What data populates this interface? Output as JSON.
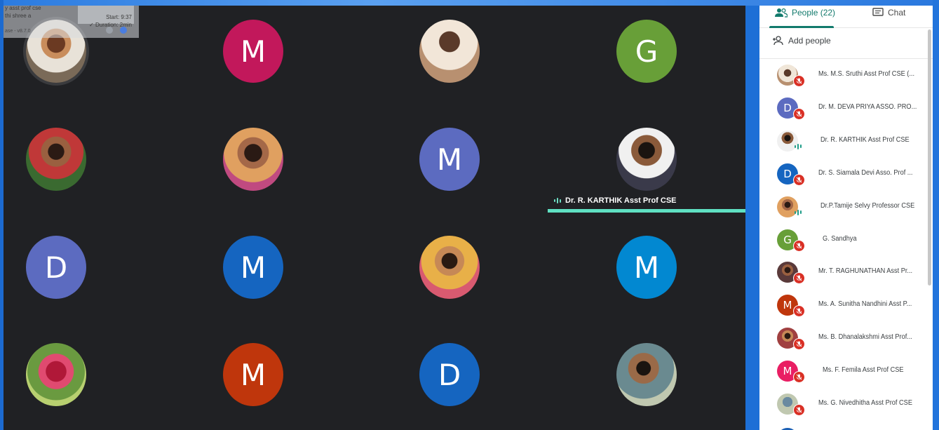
{
  "floating_window": {
    "line1": "y asst prof cse",
    "line2": "thi shree a",
    "line3": "ase - v8.7.0",
    "timer_start": "Start: 9:37",
    "timer_duration": "✓ Duration: 2min"
  },
  "speaker": {
    "name": "Dr. R. KARTHIK Asst Prof CSE",
    "accent": "#5fe0c2"
  },
  "tiles": [
    {
      "kind": "photo",
      "photo": "photo-1"
    },
    {
      "kind": "letter",
      "letter": "M",
      "color": "#c2185b"
    },
    {
      "kind": "photo",
      "photo": "photo-2"
    },
    {
      "kind": "letter",
      "letter": "G",
      "color": "#689f38"
    },
    {
      "kind": "photo",
      "photo": "photo-3"
    },
    {
      "kind": "photo",
      "photo": "photo-4"
    },
    {
      "kind": "letter",
      "letter": "M",
      "color": "#5c6bc0"
    },
    {
      "kind": "photo",
      "photo": "photo-5"
    },
    {
      "kind": "letter",
      "letter": "D",
      "color": "#5c6bc0"
    },
    {
      "kind": "letter",
      "letter": "M",
      "color": "#1565c0"
    },
    {
      "kind": "photo",
      "photo": "photo-6"
    },
    {
      "kind": "letter",
      "letter": "M",
      "color": "#0288d1"
    },
    {
      "kind": "photo",
      "photo": "photo-7"
    },
    {
      "kind": "letter",
      "letter": "M",
      "color": "#bf360c"
    },
    {
      "kind": "letter",
      "letter": "D",
      "color": "#1565c0"
    },
    {
      "kind": "photo",
      "photo": "photo-8"
    }
  ],
  "panel": {
    "tab_people": "People (22)",
    "tab_chat": "Chat",
    "add_people": "Add people",
    "accent": "#127a6c",
    "participants": [
      {
        "name": "Ms. M.S. Sruthi Asst Prof CSE (...",
        "avatar": "photo",
        "photo": "p-photo-a",
        "status": "muted"
      },
      {
        "name": "Dr. M. DEVA PRIYA ASSO. PRO...",
        "avatar": "letter",
        "letter": "D",
        "color": "#5c6bc0",
        "status": "muted"
      },
      {
        "name": "Dr. R. KARTHIK Asst Prof CSE",
        "avatar": "photo",
        "photo": "p-photo-b",
        "status": "speaking"
      },
      {
        "name": "Dr. S. Siamala Devi Asso. Prof ...",
        "avatar": "letter",
        "letter": "D",
        "color": "#1565c0",
        "status": "muted"
      },
      {
        "name": "Dr.P.Tamije Selvy Professor CSE",
        "avatar": "photo",
        "photo": "p-photo-c",
        "status": "speaking"
      },
      {
        "name": "G. Sandhya",
        "avatar": "letter",
        "letter": "G",
        "color": "#689f38",
        "status": "muted"
      },
      {
        "name": "Mr. T. RAGHUNATHAN Asst Pr...",
        "avatar": "photo",
        "photo": "p-photo-d",
        "status": "muted"
      },
      {
        "name": "Ms. A. Sunitha Nandhini Asst P...",
        "avatar": "letter",
        "letter": "M",
        "color": "#bf360c",
        "status": "muted"
      },
      {
        "name": "Ms. B. Dhanalakshmi Asst Prof...",
        "avatar": "photo",
        "photo": "p-photo-e",
        "status": "muted"
      },
      {
        "name": "Ms. F. Femila Asst Prof CSE",
        "avatar": "letter",
        "letter": "M",
        "color": "#e91e63",
        "status": "muted"
      },
      {
        "name": "Ms. G. Nivedhitha Asst Prof CSE",
        "avatar": "photo",
        "photo": "p-photo-f",
        "status": "muted"
      }
    ]
  }
}
